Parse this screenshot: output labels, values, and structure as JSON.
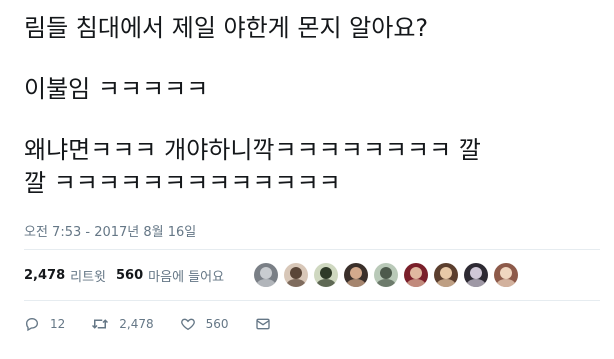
{
  "tweet": {
    "lines": [
      "림들 침대에서 제일 야한게 몬지 알아요?",
      "이불임 ㅋㅋㅋㅋㅋ",
      "왜냐면ㅋㅋㅋ 개야하니깍ㅋㅋㅋㅋㅋㅋㅋㅋ 깔",
      "깔 ㅋㅋㅋㅋㅋㅋㅋㅋㅋㅋㅋㅋㅋ"
    ],
    "timestamp": "오전 7:53 - 2017년 8월 16일"
  },
  "stats": {
    "retweets_count": "2,478",
    "retweets_label": "리트윗",
    "likes_count": "560",
    "likes_label": "마음에 들어요"
  },
  "avatars": [
    {
      "bg": "#7a7f86",
      "fg": "#c9ccd0"
    },
    {
      "bg": "#d8c7b8",
      "fg": "#5a4638"
    },
    {
      "bg": "#cfd8c0",
      "fg": "#2f3a28"
    },
    {
      "bg": "#3a2f2a",
      "fg": "#d3a98c"
    },
    {
      "bg": "#b9c9b8",
      "fg": "#4d5a4c"
    },
    {
      "bg": "#7a1f2a",
      "fg": "#e0b8a0"
    },
    {
      "bg": "#5b3e2e",
      "fg": "#e8c9a8"
    },
    {
      "bg": "#2d2a33",
      "fg": "#cfc7d6"
    },
    {
      "bg": "#8d5a4a",
      "fg": "#f0d6c0"
    }
  ],
  "actions": {
    "reply_count": "12",
    "retweet_count": "2,478",
    "like_count": "560"
  },
  "icons": {
    "reply": "reply-icon",
    "retweet": "retweet-icon",
    "like": "heart-icon",
    "message": "envelope-icon"
  },
  "colors": {
    "text": "#14171a",
    "secondary": "#657786",
    "divider": "#e6ecf0"
  }
}
